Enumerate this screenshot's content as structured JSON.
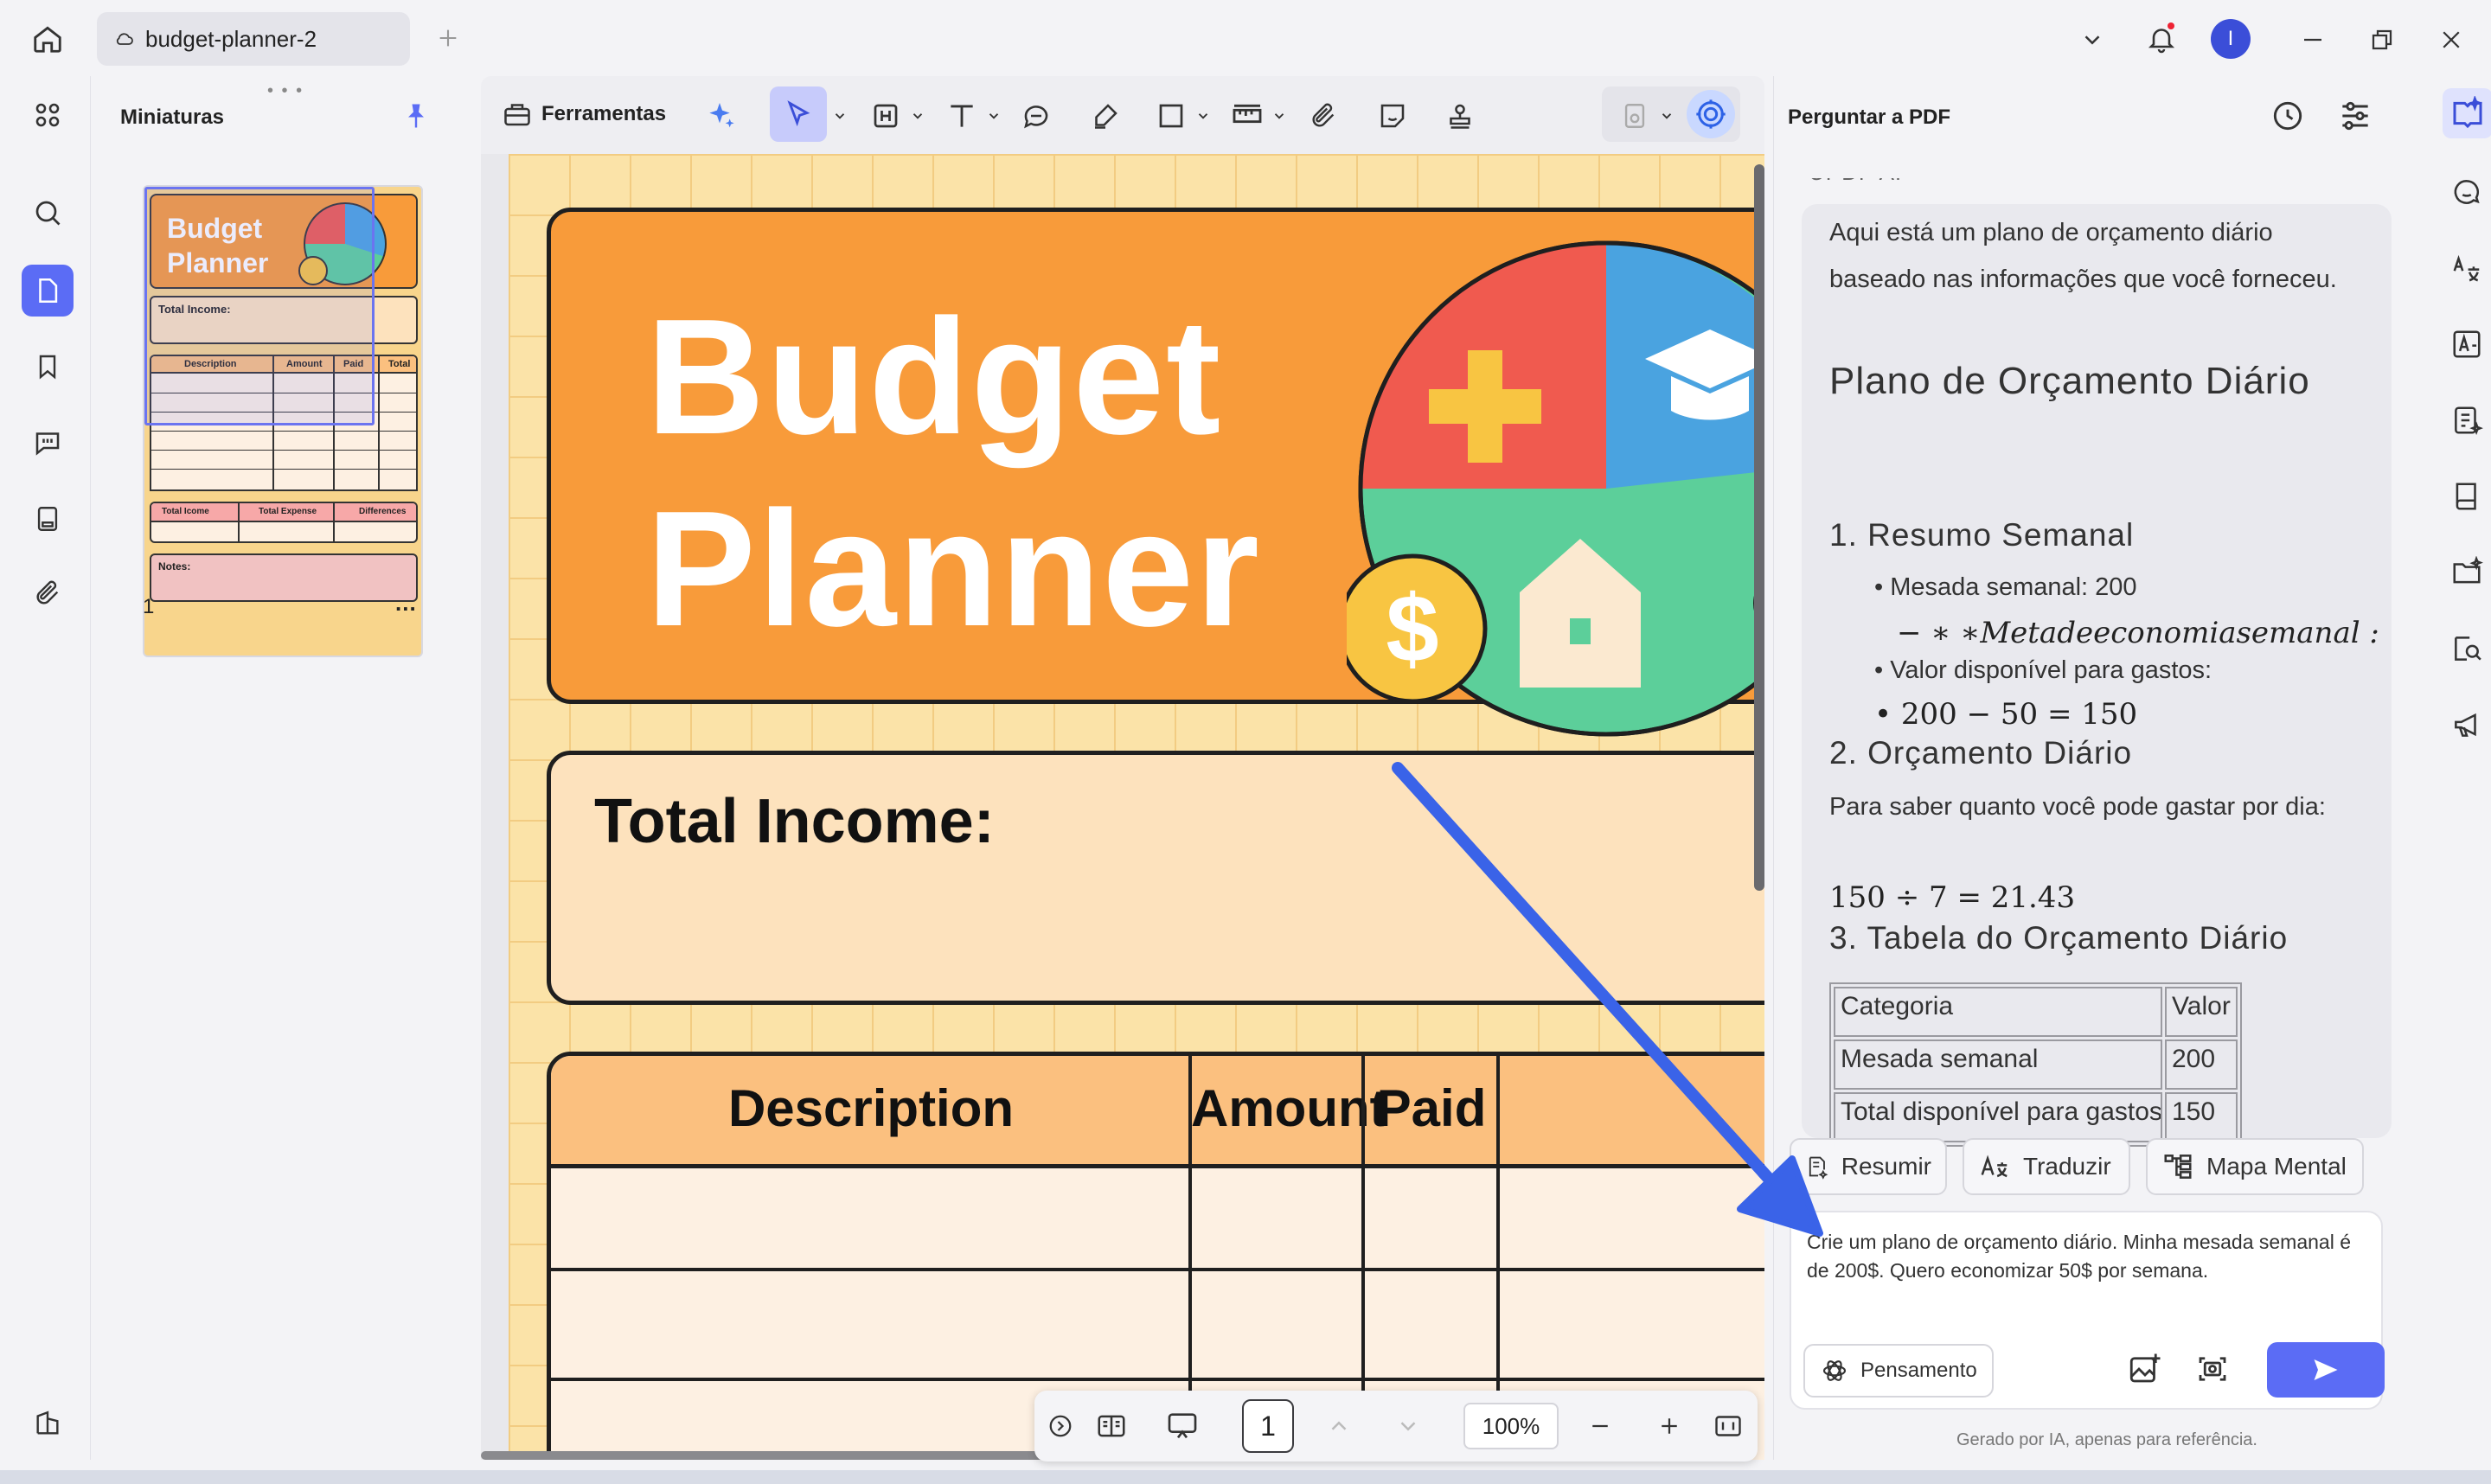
{
  "window": {
    "tab_title": "budget-planner-2",
    "avatar_letter": "I"
  },
  "left_panel": {
    "title": "Miniaturas",
    "page_number": "1",
    "more": "..."
  },
  "toolbar": {
    "tools_label": "Ferramentas"
  },
  "document": {
    "banner_title": "Budget\nPlanner",
    "income_label": "Total Income:",
    "table_headers": [
      "Description",
      "Amount",
      "Paid"
    ]
  },
  "thumbnail": {
    "title": "Budget\nPlanner",
    "income": "Total Income:",
    "headers": [
      "Description",
      "Amount",
      "Paid",
      "Total"
    ],
    "footer": [
      "Total Icome",
      "Total Expense",
      "Differences"
    ],
    "notes": "Notes:"
  },
  "pagebar": {
    "current_page": "1",
    "zoom": "100%"
  },
  "ai_panel": {
    "title": "Perguntar a PDF",
    "cut_label": "UPDF AI",
    "intro": "Aqui está um plano de orçamento diário baseado nas informações que você forneceu.",
    "heading": "Plano de Orçamento Diário",
    "section1": "1. Resumo Semanal",
    "bullet1": "Mesada semanal: 200",
    "math_broken": "− ∗ ∗Metadeeconomiasemanal :",
    "bullet2": "Valor disponível para gastos:",
    "math1": "200 − 50 = 150",
    "section2": "2. Orçamento Diário",
    "para2": "Para saber quanto você pode gastar por dia:",
    "math2": "150 ÷ 7 = 21.43",
    "section3": "3. Tabela do Orçamento Diário",
    "table": {
      "headers": [
        "Categoria",
        "Valor"
      ],
      "rows": [
        [
          "Mesada semanal",
          "200"
        ],
        [
          "Total disponível para gastos",
          "150"
        ]
      ]
    },
    "chips": [
      "Resumir",
      "Traduzir",
      "Mapa Mental"
    ],
    "prompt": "Crie um plano de orçamento diário. Minha mesada semanal é de 200$. Quero economizar 50$ por semana.",
    "think_label": "Pensamento",
    "footnote": "Gerado por IA, apenas para referência."
  },
  "colors": {
    "accent": "#5b6cf5",
    "banner_orange": "#f89b3a",
    "page_yellow": "#fbe3a8",
    "arrow_blue": "#3a63e8"
  }
}
